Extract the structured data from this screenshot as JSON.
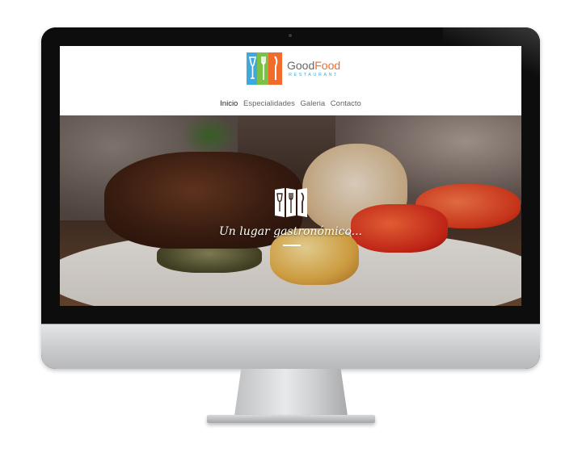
{
  "site": {
    "logo": {
      "name_part1": "Good",
      "name_part2": "Food",
      "subtitle": "RESTAURANT",
      "colors": {
        "blue": "#3fa9dc",
        "green": "#7bc143",
        "orange": "#f26b2a"
      }
    },
    "nav": {
      "items": [
        {
          "label": "Inicio",
          "active": true
        },
        {
          "label": "Especialidades",
          "active": false
        },
        {
          "label": "Galeria",
          "active": false
        },
        {
          "label": "Contacto",
          "active": false
        }
      ]
    },
    "hero": {
      "icon": "cutlery-icon",
      "tagline": "Un lugar gastronómico..."
    }
  }
}
